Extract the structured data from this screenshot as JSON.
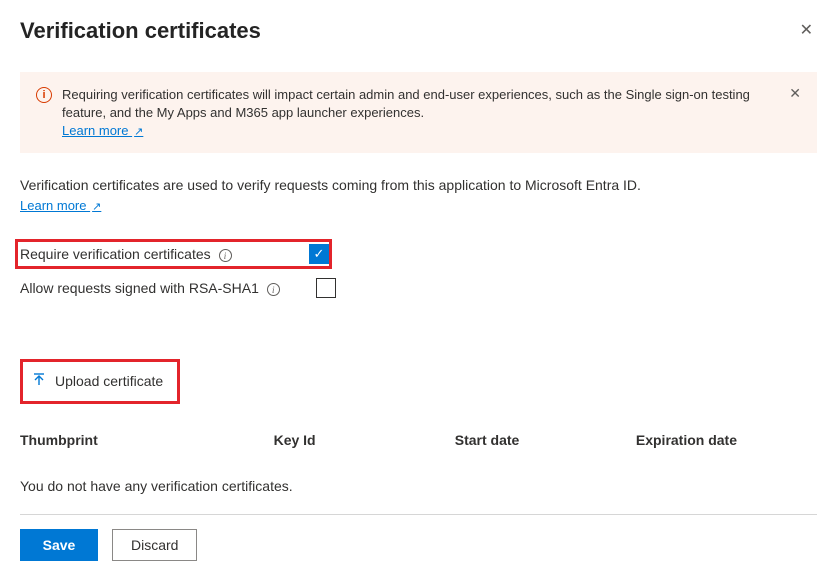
{
  "header": {
    "title": "Verification certificates"
  },
  "banner": {
    "text": "Requiring verification certificates will impact certain admin and end-user experiences, such as the Single sign-on testing feature, and the My Apps and M365 app launcher experiences.",
    "learn_more": "Learn more"
  },
  "description": {
    "text": "Verification certificates are used to verify requests coming from this application to Microsoft Entra ID.",
    "learn_more": "Learn more"
  },
  "options": {
    "require": {
      "label": "Require verification certificates",
      "checked": true
    },
    "allow_sha1": {
      "label": "Allow requests signed with RSA-SHA1",
      "checked": false
    }
  },
  "upload": {
    "label": "Upload certificate"
  },
  "table": {
    "columns": [
      "Thumbprint",
      "Key Id",
      "Start date",
      "Expiration date"
    ],
    "empty": "You do not have any verification certificates."
  },
  "footer": {
    "save": "Save",
    "discard": "Discard"
  }
}
